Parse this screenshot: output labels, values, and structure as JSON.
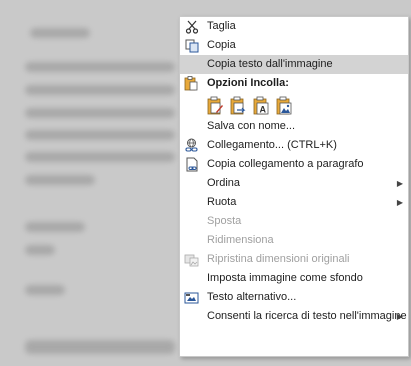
{
  "menu": {
    "items": [
      {
        "label": "Taglia",
        "icon": "scissors-icon"
      },
      {
        "label": "Copia",
        "icon": "copy-icon"
      },
      {
        "label": "Copia testo dall'immagine",
        "icon": "",
        "highlight": true
      },
      {
        "label": "Opzioni Incolla:",
        "icon": "paste-icon",
        "header": true
      },
      {
        "label": "Salva con nome...",
        "icon": ""
      },
      {
        "label": "Collegamento... (CTRL+K)",
        "icon": "link-icon"
      },
      {
        "label": "Copia collegamento a paragrafo",
        "icon": "copy-link-icon"
      },
      {
        "label": "Ordina",
        "icon": "",
        "submenu": true
      },
      {
        "label": "Ruota",
        "icon": "",
        "submenu": true
      },
      {
        "label": "Sposta",
        "icon": "",
        "disabled": true
      },
      {
        "label": "Ridimensiona",
        "icon": "",
        "disabled": true
      },
      {
        "label": "Ripristina dimensioni originali",
        "icon": "reset-image-icon",
        "disabled": true
      },
      {
        "label": "Imposta immagine come sfondo",
        "icon": ""
      },
      {
        "label": "Testo alternativo...",
        "icon": "alt-text-icon"
      },
      {
        "label": "Consenti la ricerca di testo nell'immagine",
        "icon": "",
        "submenu": true
      }
    ],
    "paste_options": [
      {
        "icon": "paste-keep-formatting-icon"
      },
      {
        "icon": "paste-merge-formatting-icon"
      },
      {
        "icon": "paste-text-only-icon",
        "glyph": "A"
      },
      {
        "icon": "paste-picture-icon"
      }
    ],
    "submenu_arrow": "▶"
  },
  "colors": {
    "highlight": "#d3d3d3",
    "disabled_text": "#a0a0a0",
    "icon_blue": "#2b579a",
    "icon_gold": "#e8a93a"
  }
}
